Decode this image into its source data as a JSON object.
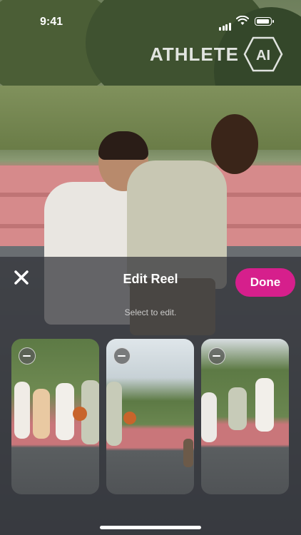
{
  "status_bar": {
    "time": "9:41"
  },
  "logo": {
    "text": "ATHLETE",
    "mark": "AI"
  },
  "sheet": {
    "title": "Edit Reel",
    "done_label": "Done",
    "hint": "Select to edit."
  },
  "icons": {
    "close": "close-icon",
    "remove": "minus-circle-icon"
  },
  "colors": {
    "accent": "#d61f8c"
  },
  "clips": [
    {
      "name": "clip-1"
    },
    {
      "name": "clip-2"
    },
    {
      "name": "clip-3"
    }
  ]
}
